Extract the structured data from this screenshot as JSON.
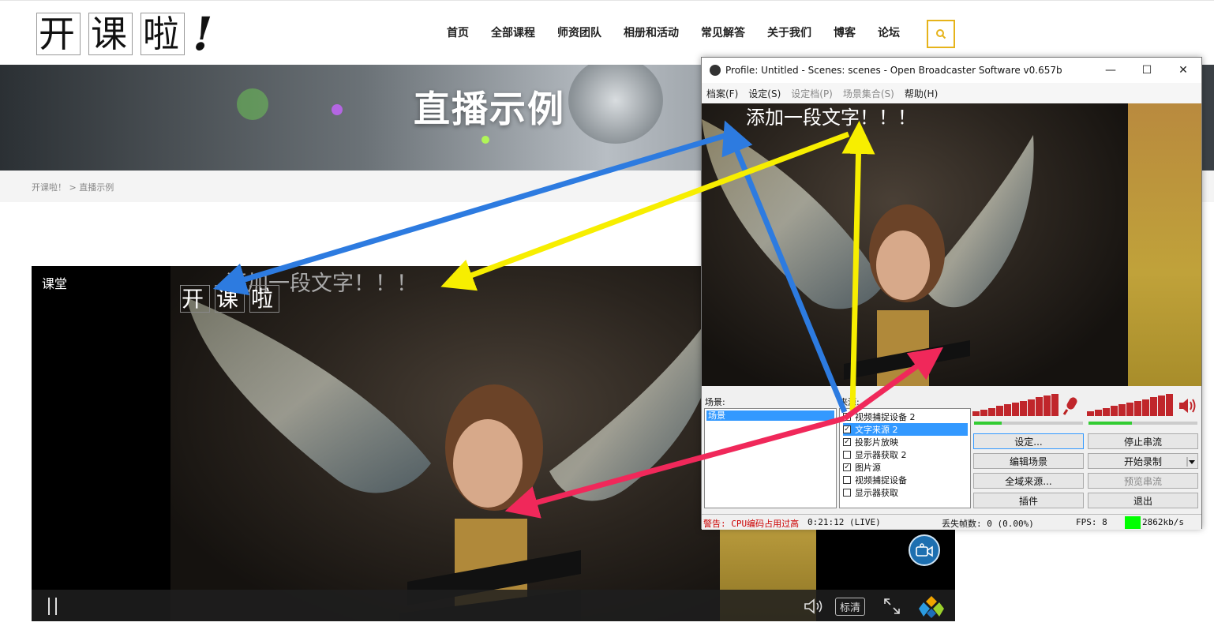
{
  "site": {
    "logo": {
      "c1": "开",
      "c2": "课",
      "c3": "啦",
      "bang": "!"
    },
    "nav": [
      "首页",
      "全部课程",
      "师资团队",
      "相册和活动",
      "常见解答",
      "关于我们",
      "博客",
      "论坛"
    ],
    "search_icon": "search-icon",
    "banner_title": "直播示例",
    "breadcrumb": "开课啦！ > 直播示例"
  },
  "player": {
    "label": "课堂",
    "overlay_text": "添加一段文字！！！",
    "overlay_logo": {
      "c1": "开",
      "c2": "课",
      "c3": "啦"
    },
    "quality": "标清",
    "icons": [
      "pause-icon",
      "volume-icon",
      "fullscreen-icon",
      "brand-icon",
      "camera-icon"
    ]
  },
  "obs": {
    "title": "Profile: Untitled - Scenes: scenes - Open Broadcaster Software v0.657b",
    "window_buttons": {
      "minimize": "—",
      "maximize": "☐",
      "close": "✕"
    },
    "menu": [
      {
        "label": "档案(F)",
        "enabled": true
      },
      {
        "label": "设定(S)",
        "enabled": true
      },
      {
        "label": "设定档(P)",
        "enabled": false
      },
      {
        "label": "场景集合(S)",
        "enabled": false
      },
      {
        "label": "帮助(H)",
        "enabled": true
      }
    ],
    "preview_text": "添加一段文字！！！",
    "scenes_label": "场景:",
    "scenes": [
      "场景"
    ],
    "sources_label": "来源:",
    "sources": [
      {
        "label": "视频捕捉设备 2",
        "checked": false,
        "selected": false
      },
      {
        "label": "文字来源 2",
        "checked": true,
        "selected": true
      },
      {
        "label": "投影片放映",
        "checked": true,
        "selected": false
      },
      {
        "label": "显示器获取 2",
        "checked": false,
        "selected": false
      },
      {
        "label": "图片源",
        "checked": true,
        "selected": false
      },
      {
        "label": "视频捕捉设备",
        "checked": false,
        "selected": false
      },
      {
        "label": "显示器获取",
        "checked": false,
        "selected": false
      }
    ],
    "check_mark": "✓",
    "mic_icon": "microphone-icon",
    "speaker_icon": "speaker-icon",
    "mic_level": 0.25,
    "speaker_level": 0.4,
    "buttons": {
      "settings": "设定...",
      "stop_stream": "停止串流",
      "edit_scene": "编辑场景",
      "start_record": "开始录制",
      "global_sources": "全域来源...",
      "preview_stream": "预览串流",
      "plugins": "插件",
      "exit": "退出"
    },
    "status": {
      "warning": "警告: CPU编码占用过高",
      "time": "0:21:12 (LIVE)",
      "dropped": "丢失帧数: 0 (0.00%)",
      "fps": "FPS: 8",
      "bitrate": "2862kb/s"
    },
    "colors": {
      "warning": "#cc0000",
      "fps_indicator": "#00ff00",
      "selection": "#3399ff"
    }
  },
  "annotations": {
    "colors": {
      "blue": "#2d7be0",
      "yellow": "#f7ee00",
      "pink": "#f0285a"
    }
  }
}
